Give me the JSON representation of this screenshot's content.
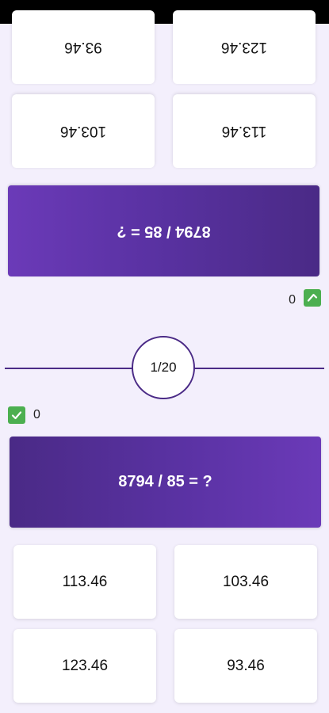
{
  "round": {
    "label": "1/20"
  },
  "colors": {
    "accent": "#4a2a86",
    "score_check": "#4caf50",
    "background": "#f3effc"
  },
  "players": {
    "top": {
      "score": "0",
      "score_icon": "check-icon",
      "question": "8794 / 85  =  ?",
      "answers": [
        "113.46",
        "103.46",
        "123.46",
        "93.46"
      ]
    },
    "bottom": {
      "score": "0",
      "score_icon": "check-icon",
      "question": "8794 / 85  =  ?",
      "answers": [
        "113.46",
        "103.46",
        "123.46",
        "93.46"
      ]
    }
  }
}
